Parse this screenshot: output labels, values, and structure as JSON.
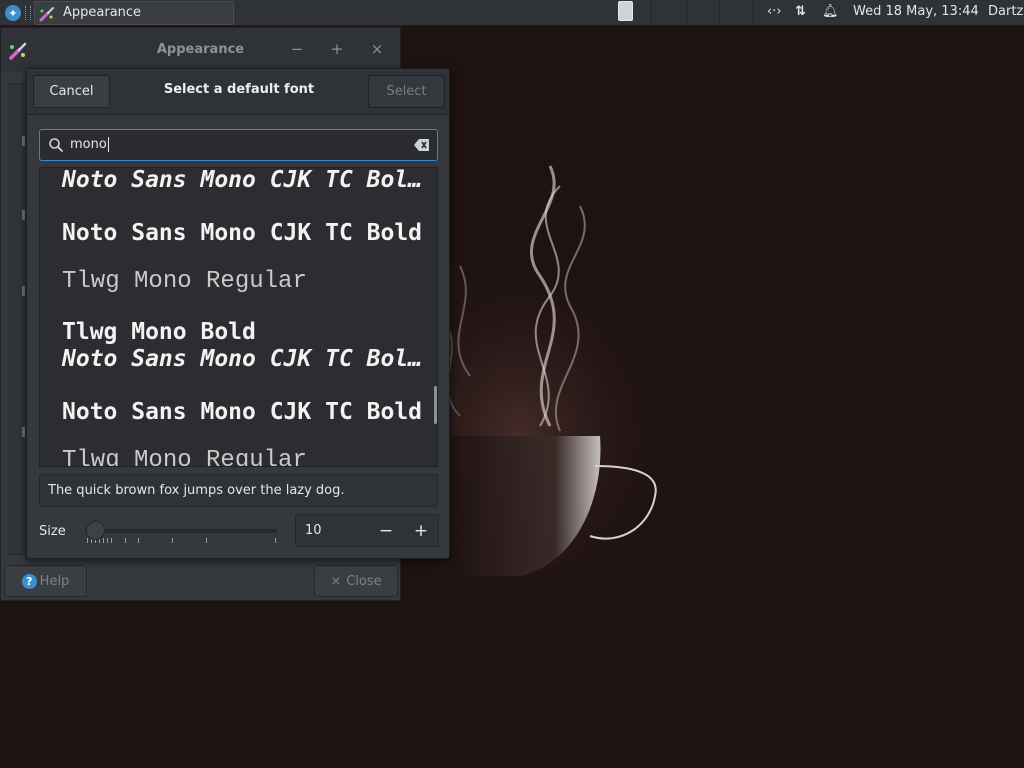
{
  "panel": {
    "task_label": "Appearance",
    "tray": {
      "network_icon": "network-wired-icon",
      "transfer_icon": "updown-arrows-icon",
      "notify_icon": "bell-icon"
    },
    "clock": "Wed 18 May, 13:44",
    "user": "Dartz"
  },
  "appearance_window": {
    "title": "Appearance",
    "minimize": "−",
    "maximize": "+",
    "close": "×",
    "help_label": "Help",
    "close_label": "Close",
    "close_icon": "×"
  },
  "font_dialog": {
    "title": "Select a default font",
    "cancel_label": "Cancel",
    "select_label": "Select",
    "search_value": "mono",
    "fonts": [
      {
        "label": "Noto Sans Mono CJK TC Bol…"
      },
      {
        "label": "Noto Sans Mono CJK TC Bold"
      },
      {
        "label": "Tlwg Mono Regular"
      },
      {
        "label": "Tlwg Mono Bold"
      },
      {
        "label": "Noto Sans Mono CJK TC Bol…"
      },
      {
        "label": "Noto Sans Mono CJK TC Bold"
      },
      {
        "label": "Tlwg Mono Regular"
      }
    ],
    "preview_text": "The quick brown fox jumps over the lazy dog.",
    "size_label": "Size",
    "size_value": "10",
    "size_minus": "−",
    "size_plus": "+"
  },
  "colors": {
    "accent": "#3f86c6",
    "desktop": "#1e1212",
    "dialog_bg": "#35383c"
  }
}
